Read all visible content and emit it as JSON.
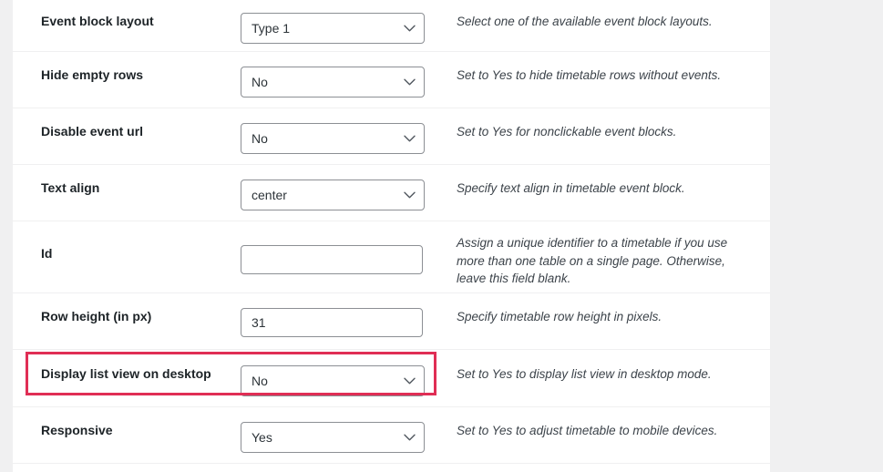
{
  "panel": {
    "rows": [
      {
        "label": "Event block layout",
        "control": {
          "kind": "select",
          "value": "Type 1"
        },
        "description": "Select one of the available event block layouts."
      },
      {
        "label": "Hide empty rows",
        "control": {
          "kind": "select",
          "value": "No"
        },
        "description": "Set to Yes to hide timetable rows without events."
      },
      {
        "label": "Disable event url",
        "control": {
          "kind": "select",
          "value": "No"
        },
        "description": "Set to Yes for nonclickable event blocks."
      },
      {
        "label": "Text align",
        "control": {
          "kind": "select",
          "value": "center"
        },
        "description": "Specify text align in timetable event block."
      },
      {
        "label": "Id",
        "control": {
          "kind": "text",
          "value": "",
          "placeholder": ""
        },
        "description": "Assign a unique identifier to a timetable if you use more than one table on a single page. Otherwise, leave this field blank."
      },
      {
        "label": "Row height (in px)",
        "control": {
          "kind": "text",
          "value": "31",
          "placeholder": ""
        },
        "description": "Specify timetable row height in pixels."
      },
      {
        "label": "Display list view on desktop",
        "control": {
          "kind": "select",
          "value": "No"
        },
        "description": "Set to Yes to display list view in desktop mode."
      },
      {
        "label": "Responsive",
        "control": {
          "kind": "select",
          "value": "Yes"
        },
        "description": "Set to Yes to adjust timetable to mobile devices."
      }
    ]
  },
  "annotation": {
    "name": "highlight-rectangle",
    "target_label": "Display list view on desktop",
    "color": "#e02e55"
  },
  "colors": {
    "page_background": "#f0f0f1",
    "panel_background": "#ffffff",
    "label_text": "#1d2327",
    "description_text": "#3c434a",
    "control_border": "#8c8f94",
    "row_divider": "#f0f0f1",
    "highlight": "#e02e55"
  }
}
